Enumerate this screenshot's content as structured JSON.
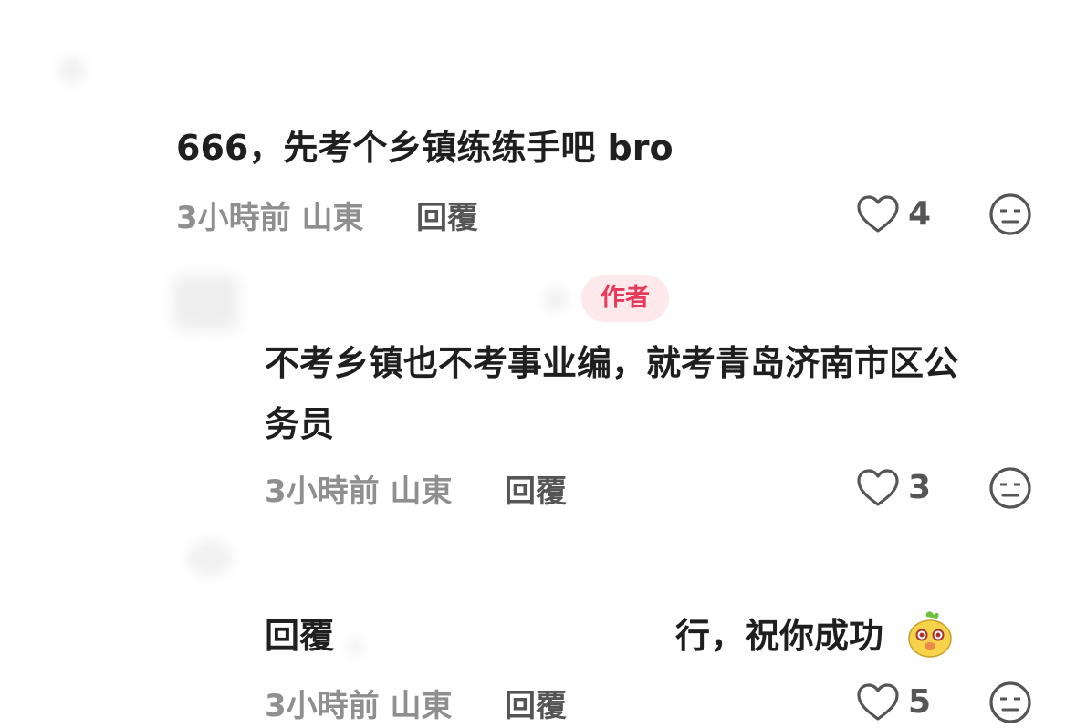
{
  "comments": [
    {
      "text": "666，先考个乡镇练练手吧 bro",
      "meta": "3小時前 山東",
      "reply_label": "回覆",
      "likes": "4"
    },
    {
      "author_badge": "作者",
      "text_line1": "不考乡镇也不考事业编，就考青岛济南市区公",
      "text_line2": "务员",
      "meta": "3小時前 山東",
      "reply_label": "回覆",
      "likes": "3"
    },
    {
      "prefix": "回覆",
      "text": "行，祝你成功",
      "meta": "3小時前 山東",
      "reply_label": "回覆",
      "likes": "5"
    }
  ],
  "icons": {
    "like": "heart-outline-icon",
    "dislike": "unamused-face-icon",
    "emoji": "mascot-sticker-icon"
  },
  "colors": {
    "author_badge_bg": "#fde8ec",
    "author_badge_text": "#e53a5a",
    "meta_text": "#8f8f8f",
    "icon_stroke": "#555555"
  }
}
